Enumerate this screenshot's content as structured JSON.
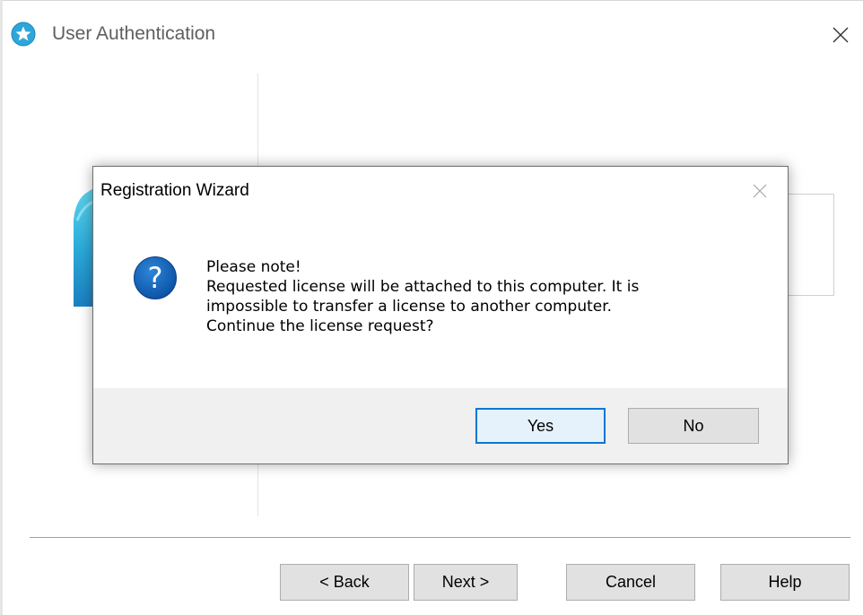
{
  "window": {
    "title": "User Authentication",
    "close_glyph": "✕",
    "app_icon": "star-badge-icon",
    "accent_color": "#0078d7"
  },
  "footer_buttons": {
    "back": "< Back",
    "next": "Next >",
    "cancel": "Cancel",
    "help": "Help"
  },
  "dialog": {
    "title": "Registration Wizard",
    "close_glyph": "✕",
    "icon": "question-icon",
    "icon_glyph": "?",
    "message_lines": [
      "Please note!",
      "Requested license will be attached to this computer. It is",
      "impossible to transfer a license to another computer.",
      "Continue the license request?"
    ],
    "yes_label": "Yes",
    "no_label": "No"
  }
}
